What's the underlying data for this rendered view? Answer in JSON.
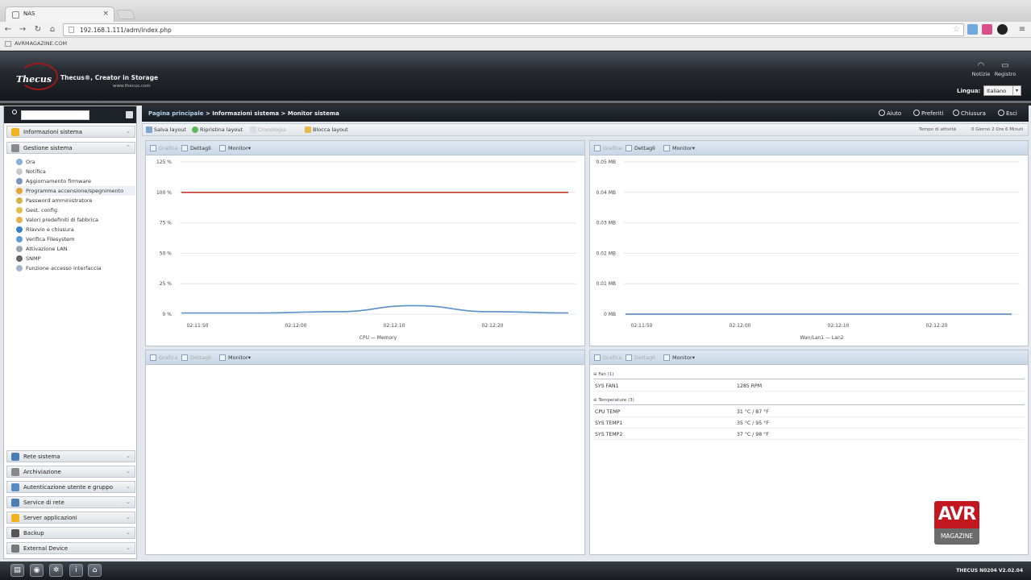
{
  "browser": {
    "tab_title": "NAS",
    "url": "192.168.1.111/adm/index.php",
    "bookmark": "AVRMAGAZINE.COM"
  },
  "header": {
    "logo": "Thecus",
    "tagline": "Thecus®, Creator in Storage",
    "website": "www.thecus.com",
    "links": [
      {
        "label": "Notizie",
        "icon": "rss-icon"
      },
      {
        "label": "Registro",
        "icon": "chat-icon"
      }
    ],
    "language_label": "Lingua:",
    "language_value": "Italiano"
  },
  "sidebar": {
    "categories_top": [
      {
        "label": "Informazioni sistema",
        "icon": "info-icon",
        "color": "#f2b21c"
      },
      {
        "label": "Gestione sistema",
        "icon": "tools-icon",
        "color": "#7a7a7a"
      }
    ],
    "items": [
      {
        "label": "Ora"
      },
      {
        "label": "Notifica"
      },
      {
        "label": "Aggiornamento firmware"
      },
      {
        "label": "Programma accensione/spegnimento"
      },
      {
        "label": "Password amministratore"
      },
      {
        "label": "Gest. config."
      },
      {
        "label": "Valori predefiniti di fabbrica"
      },
      {
        "label": "Riavvio e chiusura"
      },
      {
        "label": "Verifica Filesystem"
      },
      {
        "label": "Attivazione LAN"
      },
      {
        "label": "SNMP"
      },
      {
        "label": "Funzione accesso interfaccia"
      }
    ],
    "categories_bottom": [
      {
        "label": "Rete sistema",
        "icon": "network-icon",
        "color": "#4a7fb5"
      },
      {
        "label": "Archiviazione",
        "icon": "storage-icon",
        "color": "#888888"
      },
      {
        "label": "Autenticazione utente e gruppo",
        "icon": "users-icon",
        "color": "#5a8ac2"
      },
      {
        "label": "Service di rete",
        "icon": "service-icon",
        "color": "#4a7fb5"
      },
      {
        "label": "Server applicazioni",
        "icon": "apps-icon",
        "color": "#f2b21c"
      },
      {
        "label": "Backup",
        "icon": "backup-icon",
        "color": "#555555"
      },
      {
        "label": "External Device",
        "icon": "device-icon",
        "color": "#777777"
      }
    ]
  },
  "breadcrumb": {
    "home": "Pagina principale",
    "section": "Informazioni sistema",
    "page": "Monitor sistema",
    "actions": [
      {
        "label": "Aiuto"
      },
      {
        "label": "Preferiti"
      },
      {
        "label": "Chiusura"
      },
      {
        "label": "Esci"
      }
    ]
  },
  "layout_toolbar": {
    "save": "Salva layout",
    "reset": "Ripristina layout",
    "overview": "Cronologia",
    "lock": "Blocca layout",
    "refresh_label": "Tempo di attività",
    "refresh_value": "0 Giorno 2 Ore 6 Minuti"
  },
  "panels": {
    "chart_btn": "Grafica",
    "details_btn": "Dettagli",
    "monitor_btn": "Monitor"
  },
  "chart_data": [
    {
      "type": "line",
      "x": [
        "02:11:50",
        "02:12:00",
        "02:12:10",
        "02:12:20"
      ],
      "ylim": [
        0,
        125
      ],
      "yticks": [
        "125 %",
        "100 %",
        "75 %",
        "50 %",
        "25 %",
        "0 %"
      ],
      "series": [
        {
          "name": "CPU",
          "color": "#5a8fc7",
          "values": [
            1,
            1,
            2,
            7,
            2,
            1
          ]
        },
        {
          "name": "Memory",
          "color": "#c0392b",
          "values": [
            100,
            100,
            100,
            100,
            100,
            100
          ]
        }
      ],
      "legend": "CPU — Memory",
      "grid": true
    },
    {
      "type": "line",
      "x": [
        "02:11:50",
        "02:12:00",
        "02:12:10",
        "02:12:20"
      ],
      "ylim": [
        0,
        0.05
      ],
      "yticks": [
        "0.05 MB",
        "0.04 MB",
        "0.03 MB",
        "0.02 MB",
        "0.01 MB",
        "0 MB"
      ],
      "series": [
        {
          "name": "Wan/Lan1",
          "color": "#5a8fc7",
          "values": [
            0,
            0,
            0,
            0,
            0,
            0
          ]
        },
        {
          "name": "Lan2",
          "color": "#999999",
          "values": [
            0,
            0,
            0,
            0,
            0,
            0
          ]
        }
      ],
      "legend": "Wan/Lan1 — Lan2",
      "grid": true
    }
  ],
  "sensors": {
    "fan_title": "Fan (1)",
    "fans": [
      {
        "name": "SYS FAN1",
        "value": "1285 RPM"
      }
    ],
    "temp_title": "Temperature (3)",
    "temps": [
      {
        "name": "CPU TEMP",
        "value": "31 °C / 87 °F"
      },
      {
        "name": "SYS TEMP1",
        "value": "35 °C / 95 °F"
      },
      {
        "name": "SYS TEMP2",
        "value": "37 °C / 98 °F"
      }
    ]
  },
  "watermark": {
    "top": "AVR",
    "bottom": "MAGAZINE"
  },
  "footer": {
    "version": "THECUS N0204 V2.02.04"
  }
}
